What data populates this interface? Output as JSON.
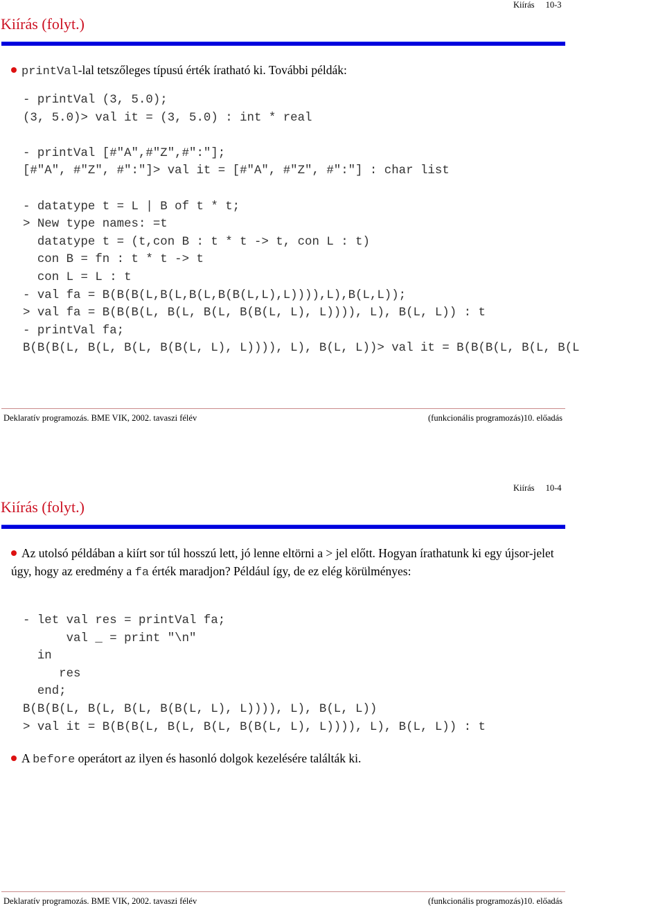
{
  "colors": {
    "title": "#cc1122",
    "rule": "#0000dd",
    "bullet": "#dd1111",
    "footer_rule": "#c98a8a"
  },
  "slides": [
    {
      "running_head": {
        "section": "Kiírás",
        "page": "10-3"
      },
      "title": "Kiírás (folyt.)",
      "bullet1": {
        "code": "printVal",
        "text": "-lal tetszőleges típusú érték íratható ki. További példák:"
      },
      "code_lines": [
        "- printVal (3, 5.0);",
        "(3, 5.0)> val it = (3, 5.0) : int * real",
        "",
        "- printVal [#\"A\",#\"Z\",#\":\"];",
        "[#\"A\", #\"Z\", #\":\"]> val it = [#\"A\", #\"Z\", #\":\"] : char list",
        "",
        "- datatype t = L | B of t * t;",
        "> New type names: =t",
        "  datatype t = (t,con B : t * t -> t, con L : t)",
        "  con B = fn : t * t -> t",
        "  con L = L : t",
        "- val fa = B(B(B(L,B(L,B(L,B(B(L,L),L)))),L),B(L,L));",
        "> val fa = B(B(B(L, B(L, B(L, B(B(L, L), L)))), L), B(L, L)) : t",
        "- printVal fa;",
        "B(B(B(L, B(L, B(L, B(B(L, L), L)))), L), B(L, L))> val it = B(B(B(L, B(L, B(L"
      ],
      "footer": {
        "left": "Deklaratív programozás. BME VIK, 2002. tavaszi félév",
        "right": "(funkcionális programozás)10. előadás"
      }
    },
    {
      "running_head": {
        "section": "Kiírás",
        "page": "10-4"
      },
      "title": "Kiírás (folyt.)",
      "bullet1": {
        "text_before": "Az utolsó példában a kiírt sor túl hosszú lett, jó lenne eltörni a > jel előtt. Hogyan írathatunk ki egy újsor-jelet úgy, hogy az eredmény a ",
        "code": "fa",
        "text_after": " érték maradjon? Például így, de ez elég körülményes:"
      },
      "code_lines": [
        "- let val res = printVal fa;",
        "      val _ = print \"\\n\"",
        "  in",
        "     res",
        "  end;",
        "B(B(B(L, B(L, B(L, B(B(L, L), L)))), L), B(L, L))",
        "> val it = B(B(B(L, B(L, B(L, B(B(L, L), L)))), L), B(L, L)) : t"
      ],
      "bullet2": {
        "text_before": "A ",
        "code": "before",
        "text_after": " operátort az ilyen és hasonló dolgok kezelésére találták ki."
      },
      "footer": {
        "left": "Deklaratív programozás. BME VIK, 2002. tavaszi félév",
        "right": "(funkcionális programozás)10. előadás"
      }
    }
  ]
}
